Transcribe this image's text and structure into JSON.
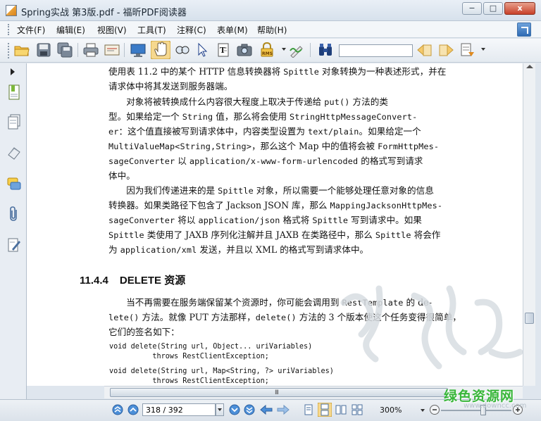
{
  "window": {
    "title": "Spring实战 第3版.pdf - 福昕PDF阅读器",
    "minimize_label": "−",
    "maximize_label": "□",
    "close_label": "x"
  },
  "menu": {
    "items": [
      {
        "label": "文件(F)"
      },
      {
        "label": "编辑(E)"
      },
      {
        "label": "视图(V)"
      },
      {
        "label": "工具(T)"
      },
      {
        "label": "注释(C)"
      },
      {
        "label": "表单(M)"
      },
      {
        "label": "帮助(H)"
      }
    ]
  },
  "toolbar": {
    "search_value": "",
    "icons": [
      "open-folder-icon",
      "save-icon",
      "save-all-icon",
      "print-icon",
      "scan-icon",
      "fullscreen-icon",
      "hand-tool-icon",
      "zoom-tool-icon",
      "select-arrow-icon",
      "text-select-icon",
      "snapshot-icon",
      "rms-lock-icon",
      "signature-icon",
      "binoculars-icon",
      "find-prev-icon",
      "find-next-icon",
      "highlight-icon"
    ],
    "rms_label": "RMS"
  },
  "document": {
    "lines": [
      {
        "t": "使用表 11.2 中的某个 HTTP 信息转换器将 ",
        "m": "Spittle",
        "t2": " 对象转换为一种表述形式，并在"
      },
      {
        "t": "请求体中将其发送到服务器端。"
      },
      {
        "t": "　　对象将被转换成什么内容很大程度上取决于传递给 ",
        "m": "put()",
        "t2": " 方法的类"
      },
      {
        "t": "型。如果给定一个 ",
        "m": "String",
        "t2": " 值，那么将会使用 ",
        "m2": "StringHttpMessageConvert-"
      },
      {
        "m": "er",
        "t2": "：这个值直接被写到请求体中，内容类型设置为 ",
        "m2": "text/plain",
        "t3": "。如果给定一个"
      },
      {
        "m": "MultiValueMap<String,String>",
        "t2": "，那么这个 Map 中的值将会被 ",
        "m2": "FormHttpMes-"
      },
      {
        "m": "sageConverter",
        "t2": " 以 ",
        "m2": "application/x-www-form-urlencoded",
        "t3": " 的格式写到请求"
      },
      {
        "t": "体中。"
      },
      {
        "t": "　　因为我们传递进来的是 ",
        "m": "Spittle",
        "t2": " 对象，所以需要一个能够处理任意对象的信息"
      },
      {
        "t": "转换器。如果类路径下包含了 Jackson JSON 库，那么 ",
        "m": "MappingJacksonHttpMes-"
      },
      {
        "m": "sageConverter",
        "t2": " 将以 ",
        "m2": "application/json",
        "t3": " 格式将 ",
        "m3": "Spittle",
        "t4": " 写到请求中。如果"
      },
      {
        "m": "Spittle",
        "t2": " 类使用了 JAXB 序列化注解并且 JAXB 在类路径中，那么 ",
        "m2": "Spittle",
        "t3": " 将会作"
      },
      {
        "t": "为 ",
        "m": "application/xml",
        "t2": " 发送，并且以 XML 的格式写到请求体中。"
      }
    ],
    "heading_number": "11.4.4",
    "heading_title": "DELETE 资源",
    "lines2": [
      {
        "t": "　　当不再需要在服务端保留某个资源时，你可能会调用到 ",
        "m": "RestTemplate",
        "t2": " 的 de-"
      },
      {
        "m": "lete()",
        "t2": " 方法。就像 PUT 方法那样，",
        "m2": "delete()",
        "t3": " 方法的 3 个版本使这个任务变得很简单，"
      },
      {
        "t": "它们的签名如下："
      }
    ],
    "code": [
      "void delete(String url, Object... uriVariables)",
      "          throws RestClientException;",
      "void delete(String url, Map<String, ?> uriVariables)",
      "          throws RestClientException;"
    ]
  },
  "scroll": {
    "grip": "III"
  },
  "status": {
    "page_value": "318 / 392",
    "zoom": "300%",
    "icons": [
      "first-page-icon",
      "prev-page-icon",
      "next-page-icon",
      "last-page-icon",
      "go-back-icon",
      "go-forward-icon",
      "single-page-icon",
      "continuous-icon",
      "facing-icon",
      "continuous-facing-icon",
      "zoom-out-icon",
      "zoom-in-icon"
    ]
  },
  "watermarks": {
    "site": "绿色资源网",
    "url": "www.downcc.com"
  }
}
